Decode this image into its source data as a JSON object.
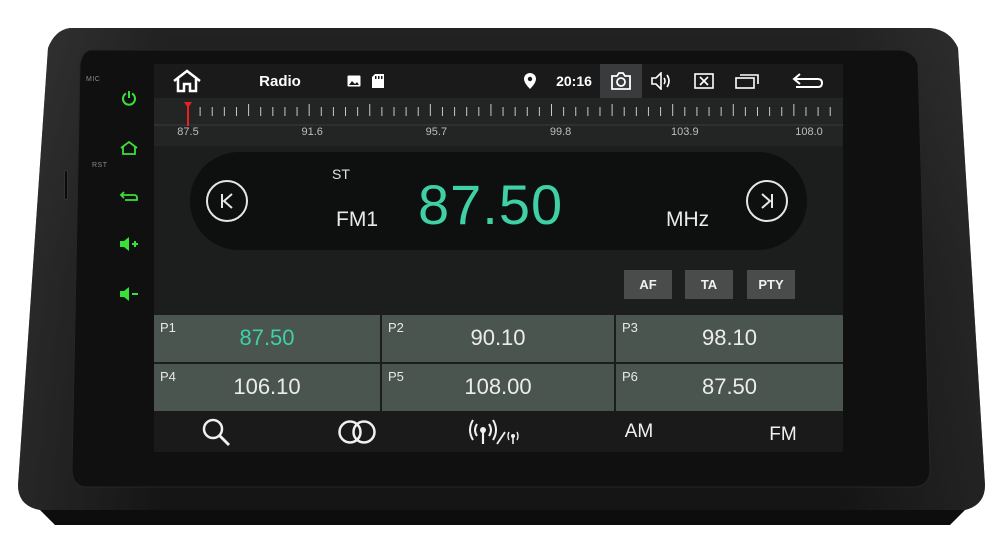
{
  "colors": {
    "accent": "#3fd0a5",
    "hw_button_green": "#39e03a",
    "tuner_marker": "#e82020",
    "preset_bg": "#4a5550"
  },
  "hardware": {
    "mic_label": "MIC",
    "rst_label": "RST",
    "buttons": [
      {
        "name": "power",
        "icon": "power-icon"
      },
      {
        "name": "home",
        "icon": "home-icon"
      },
      {
        "name": "back",
        "icon": "back-icon"
      },
      {
        "name": "volume-up",
        "icon": "volume-up-icon"
      },
      {
        "name": "volume-down",
        "icon": "volume-down-icon"
      }
    ]
  },
  "statusbar": {
    "title": "Radio",
    "time": "20:16",
    "icons": [
      "home-icon",
      "gallery-icon",
      "sd-card-icon",
      "location-icon",
      "camera-icon",
      "volume-icon",
      "close-window-icon",
      "recent-apps-icon",
      "back-arrow-icon"
    ]
  },
  "tuner": {
    "range": [
      87.5,
      108.0
    ],
    "current": 87.5,
    "tick_labels": [
      "87.5",
      "91.6",
      "95.7",
      "99.8",
      "103.9",
      "108.0"
    ]
  },
  "display": {
    "stereo": "ST",
    "band": "FM1",
    "frequency": "87.50",
    "unit": "MHz"
  },
  "options": [
    {
      "label": "AF"
    },
    {
      "label": "TA"
    },
    {
      "label": "PTY"
    }
  ],
  "presets": [
    {
      "num": "P1",
      "freq": "87.50",
      "active": true
    },
    {
      "num": "P2",
      "freq": "90.10",
      "active": false
    },
    {
      "num": "P3",
      "freq": "98.10",
      "active": false
    },
    {
      "num": "P4",
      "freq": "106.10",
      "active": false
    },
    {
      "num": "P5",
      "freq": "108.00",
      "active": false
    },
    {
      "num": "P6",
      "freq": "87.50",
      "active": false
    }
  ],
  "bottombar": {
    "am_label": "AM",
    "fm_label": "FM",
    "icons": [
      "search-icon",
      "stereo-rings-icon",
      "local-distant-icon"
    ]
  }
}
